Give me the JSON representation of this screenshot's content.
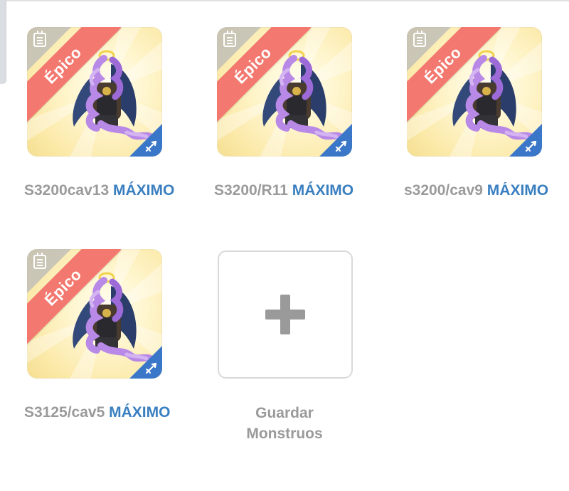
{
  "monsters": [
    {
      "rarity": "Épico",
      "name": "S3200cav13",
      "status": "MÁXIMO"
    },
    {
      "rarity": "Épico",
      "name": "S3200/R11",
      "status": "MÁXIMO"
    },
    {
      "rarity": "Épico",
      "name": "s3200/cav9",
      "status": "MÁXIMO"
    },
    {
      "rarity": "Épico",
      "name": "S3125/cav5",
      "status": "MÁXIMO"
    }
  ],
  "add_slot": {
    "line1": "Guardar",
    "line2": "Monstruos"
  },
  "icons": {
    "card_top_left": "notepad-icon",
    "card_bottom_right": "arrow-shot-icon",
    "add": "plus-icon"
  },
  "colors": {
    "ribbon": "#f3786f",
    "badge": "#3a77c8",
    "max_text": "#3a7fc0",
    "name_text": "#9a9a9a"
  }
}
